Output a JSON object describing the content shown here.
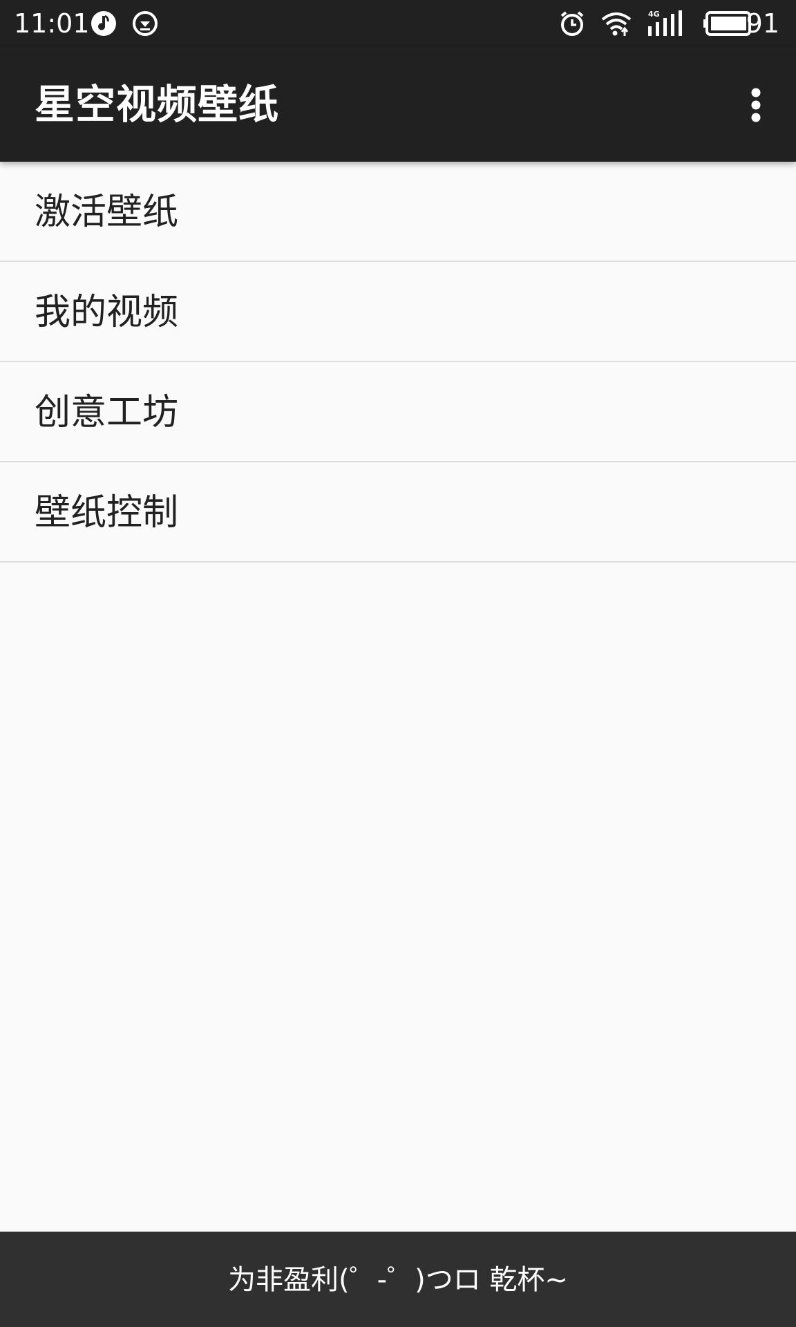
{
  "status_bar": {
    "time": "11:01",
    "battery_percent": "91",
    "icons": [
      "music-note-icon",
      "download-icon",
      "alarm-icon",
      "wifi-icon",
      "signal-4g-icon",
      "battery-icon"
    ]
  },
  "toolbar": {
    "title": "星空视频壁纸",
    "overflow_icon": "more-vert-icon"
  },
  "menu": {
    "items": [
      {
        "label": "激活壁纸"
      },
      {
        "label": "我的视频"
      },
      {
        "label": "创意工坊"
      },
      {
        "label": "壁纸控制"
      }
    ]
  },
  "footer": {
    "text": "为非盈利(゜-゜)つロ 乾杯~"
  },
  "colors": {
    "toolbar_bg": "#212121",
    "footer_bg": "#303030",
    "page_bg": "#fafafa",
    "divider": "#dcdcdc"
  }
}
